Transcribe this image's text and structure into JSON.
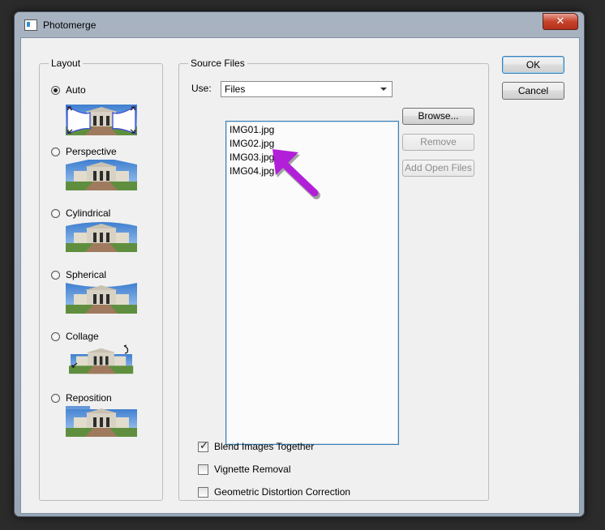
{
  "window": {
    "title": "Photomerge",
    "close_glyph": "✕"
  },
  "layout_group": {
    "legend": "Layout",
    "selected": "Auto",
    "options": [
      {
        "label": "Auto",
        "checked": true
      },
      {
        "label": "Perspective",
        "checked": false
      },
      {
        "label": "Cylindrical",
        "checked": false
      },
      {
        "label": "Spherical",
        "checked": false
      },
      {
        "label": "Collage",
        "checked": false
      },
      {
        "label": "Reposition",
        "checked": false
      }
    ]
  },
  "source_group": {
    "legend": "Source Files",
    "use_label": "Use:",
    "use_value": "Files",
    "files": [
      "IMG01.jpg",
      "IMG02.jpg",
      "IMG03.jpg",
      "IMG04.jpg"
    ],
    "buttons": {
      "browse": "Browse...",
      "remove": "Remove",
      "add_open": "Add Open Files"
    }
  },
  "options": {
    "blend": {
      "label": "Blend Images Together",
      "checked": true
    },
    "vignette": {
      "label": "Vignette Removal",
      "checked": false
    },
    "distortion": {
      "label": "Geometric Distortion Correction",
      "checked": false
    }
  },
  "actions": {
    "ok": "OK",
    "cancel": "Cancel"
  },
  "annotation": {
    "arrow_color": "#b21fd8"
  }
}
